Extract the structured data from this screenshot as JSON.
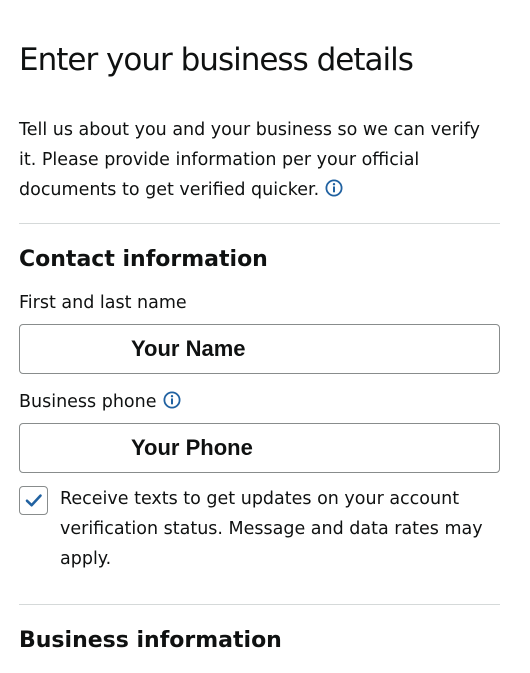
{
  "page": {
    "title": "Enter your business details",
    "intro": "Tell us about you and your business so we can verify it. Please provide information per your official documents to get verified quicker."
  },
  "contact": {
    "section_title": "Contact information",
    "name_label": "First and last name",
    "name_value": "Your Name",
    "phone_label": "Business phone",
    "phone_value": "Your Phone",
    "sms_opt_in_checked": true,
    "sms_opt_in_text": "Receive texts to get updates on your account verification status. Message and data rates may apply."
  },
  "business": {
    "section_title": "Business information"
  },
  "icons": {
    "info": "info-circle-icon",
    "check": "checkmark-icon"
  },
  "colors": {
    "text": "#0f1111",
    "info_blue": "#2162a1",
    "check_blue": "#2162a1",
    "border": "#888c8c",
    "divider": "#d5d9d9"
  }
}
